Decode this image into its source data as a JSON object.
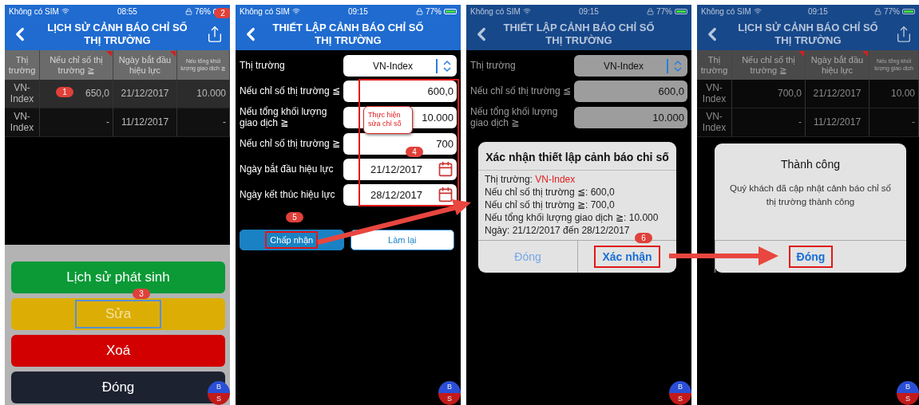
{
  "screens": [
    {
      "kind": "history",
      "dimmed": false,
      "status": {
        "carrier": "Không có SIM",
        "time": "08:55",
        "battery": "76%"
      },
      "title": "LỊCH SỬ CẢNH BÁO CHỈ SỐ THỊ TRƯỜNG",
      "share_step": "2",
      "columns": [
        {
          "label": "Thị trường",
          "flagged": false,
          "small": false
        },
        {
          "label": "Nếu chỉ số thị trường ≧",
          "flagged": true,
          "small": false
        },
        {
          "label": "Ngày bắt đầu hiệu lực",
          "flagged": true,
          "small": false
        },
        {
          "label": "Nếu tổng khối lượng giao dịch ≧",
          "flagged": false,
          "small": true
        }
      ],
      "rows": [
        {
          "cells": [
            "VN-Index",
            "650,0",
            "21/12/2017",
            "10.000"
          ],
          "selected": true,
          "step": "1"
        },
        {
          "cells": [
            "VN-Index",
            "-",
            "11/12/2017",
            "-"
          ],
          "selected": false
        }
      ],
      "sheet": [
        {
          "label": "Lịch sử phát sinh",
          "kind": "history",
          "highlighted": false
        },
        {
          "label": "Sửa",
          "kind": "edit",
          "highlighted": true,
          "step": "3"
        },
        {
          "label": "Xoá",
          "kind": "delete",
          "highlighted": false
        },
        {
          "label": "Đóng",
          "kind": "close",
          "highlighted": false
        }
      ],
      "fab": [
        "B",
        "S"
      ]
    },
    {
      "kind": "form",
      "dimmed": false,
      "status": {
        "carrier": "Không có SIM",
        "time": "09:15",
        "battery": "77%"
      },
      "title": "THIẾT LẬP CẢNH BÁO CHỈ SỐ THỊ TRƯỜNG",
      "fields": [
        {
          "label": "Thị trường",
          "value": "VN-Index",
          "kind": "select"
        },
        {
          "label": "Nếu chỉ số thị trường ≦",
          "value": "600,0",
          "kind": "number"
        },
        {
          "label": "Nếu tổng khối lượng giao dịch ≧",
          "value": "10.000",
          "kind": "number"
        },
        {
          "label": "Nếu chỉ số thị trường ≧",
          "value": "700",
          "kind": "number"
        },
        {
          "label": "Ngày bắt đầu hiệu lực",
          "value": "21/12/2017",
          "kind": "date"
        },
        {
          "label": "Ngày kết thúc hiệu lực",
          "value": "28/12/2017",
          "kind": "date"
        }
      ],
      "edit_note": {
        "text": "Thực hiện sửa chỉ số",
        "step": "4"
      },
      "buttons": [
        {
          "label": "Chấp nhận",
          "kind": "primary",
          "highlighted": true,
          "step": "5"
        },
        {
          "label": "Làm lại",
          "kind": "secondary",
          "highlighted": false
        }
      ],
      "fab": [
        "B",
        "S"
      ]
    },
    {
      "kind": "form",
      "dimmed": true,
      "status": {
        "carrier": "Không có SIM",
        "time": "09:15",
        "battery": "77%"
      },
      "title": "THIẾT LẬP CẢNH BÁO CHỈ SỐ THỊ TRƯỜNG",
      "fields": [
        {
          "label": "Thị trường",
          "value": "VN-Index",
          "kind": "select"
        },
        {
          "label": "Nếu chỉ số thị trường ≦",
          "value": "600,0",
          "kind": "number"
        },
        {
          "label": "Nếu tổng khối lượng giao dịch ≧",
          "value": "10.000",
          "kind": "number"
        }
      ],
      "dialog": {
        "kind": "confirm",
        "title": "Xác nhận thiết lập cảnh báo chỉ số",
        "market_label": "Thị trường:",
        "market": "VN-Index",
        "lines": [
          "Nếu chỉ số thị trường ≦: 600,0",
          "Nếu chỉ số thị trường ≧: 700,0",
          "Nếu tổng khối lượng giao dịch ≧: 10.000",
          "Ngày: 21/12/2017 đến 28/12/2017"
        ],
        "buttons": [
          {
            "label": "Đóng",
            "kind": "cancel",
            "highlighted": false
          },
          {
            "label": "Xác nhận",
            "kind": "confirm",
            "highlighted": true,
            "step": "6"
          }
        ]
      },
      "fab": [
        "B",
        "S"
      ]
    },
    {
      "kind": "history",
      "dimmed": true,
      "status": {
        "carrier": "Không có SIM",
        "time": "09:15",
        "battery": "77%"
      },
      "title": "LỊCH SỬ CẢNH BÁO CHỈ SỐ THỊ TRƯỜNG",
      "columns": [
        {
          "label": "Thị trường",
          "flagged": false,
          "small": false
        },
        {
          "label": "Nếu chỉ số thị trường ≧",
          "flagged": true,
          "small": false
        },
        {
          "label": "Ngày bắt đầu hiệu lực",
          "flagged": true,
          "small": false
        },
        {
          "label": "Nếu tổng khối lượng giao dịch",
          "flagged": false,
          "small": true
        }
      ],
      "rows": [
        {
          "cells": [
            "VN-Index",
            "700,0",
            "21/12/2017",
            "10.00"
          ],
          "selected": false
        },
        {
          "cells": [
            "VN-Index",
            "-",
            "11/12/2017",
            "-"
          ],
          "selected": false
        }
      ],
      "dialog": {
        "kind": "alert",
        "title": "Thành công",
        "message": "Quý khách đã cập nhật cảnh báo chỉ số thị trường thành công",
        "buttons": [
          {
            "label": "Đóng",
            "kind": "confirm",
            "highlighted": true
          }
        ]
      },
      "fab": [
        "B",
        "S"
      ]
    }
  ]
}
